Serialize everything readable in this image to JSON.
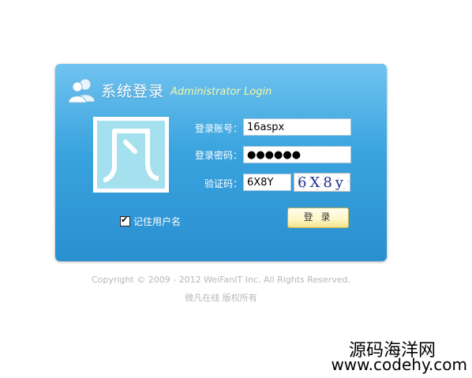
{
  "header": {
    "title": "系统登录",
    "subtitle": "Administrator Login",
    "icon": "users-icon"
  },
  "logo": {
    "char": "凡"
  },
  "form": {
    "username_label": "登录账号：",
    "username_value": "16aspx",
    "password_label": "登录密码：",
    "password_value": "●●●●●●",
    "captcha_label": "验证码：",
    "captcha_value": "6X8Y",
    "captcha_image_text": "6X8y"
  },
  "remember": {
    "label": "记住用户名",
    "checked": true
  },
  "login_button": {
    "label": "登 录"
  },
  "footer": {
    "copyright": "Copyright © 2009 - 2012 WeiFanIT Inc. All Rights Reserved.",
    "rights": "微凡在线 版权所有"
  },
  "watermark": {
    "line1": "源码海洋网",
    "line2": "www.codehy.com"
  },
  "colors": {
    "panel_top": "#6fc3ef",
    "panel_bottom": "#2a8fd0",
    "subtitle": "#f3f7a8",
    "logo_bg": "#a5e0ee"
  }
}
